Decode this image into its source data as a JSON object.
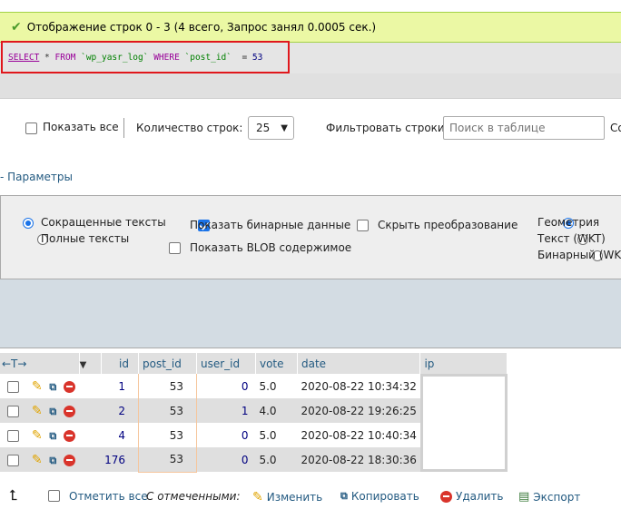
{
  "success": {
    "text": "Отображение строк 0 - 3 (4 всего, Запрос занял 0.0005 сек.)"
  },
  "sql": {
    "select": "SELECT",
    "star": " * ",
    "from": "FROM",
    "table": " `wp_yasr_log` ",
    "where": "WHERE",
    "column": " `post_id` ",
    "eq": " = ",
    "value": "53"
  },
  "controls": {
    "show_all_label": "Показать все",
    "row_count_label": "Количество строк:",
    "row_count_value": "25",
    "filter_label": "Фильтровать строки:",
    "filter_placeholder": "Поиск в таблице",
    "cut_label": "Co"
  },
  "params_link": "- Параметры",
  "options": {
    "short_texts": "Сокращенные тексты",
    "full_texts": "Полные тексты",
    "show_binary": "Показать бинарные данные",
    "show_blob": "Показать BLOB содержимое",
    "hide_transform": "Скрыть преобразование",
    "geometry": "Геометрия",
    "wkt": "Текст (WKT)",
    "wkb": "Бинарный (WKB)"
  },
  "table": {
    "nav_arrows": "←T→",
    "columns": [
      "id",
      "post_id",
      "user_id",
      "vote",
      "date",
      "ip"
    ],
    "rows": [
      {
        "id": "1",
        "post_id": "53",
        "user_id": "0",
        "vote": "5.0",
        "date": "2020-08-22 10:34:32",
        "ip": ""
      },
      {
        "id": "2",
        "post_id": "53",
        "user_id": "1",
        "vote": "4.0",
        "date": "2020-08-22 19:26:25",
        "ip": ""
      },
      {
        "id": "4",
        "post_id": "53",
        "user_id": "0",
        "vote": "5.0",
        "date": "2020-08-22 10:40:34",
        "ip": ""
      },
      {
        "id": "176",
        "post_id": "53",
        "user_id": "0",
        "vote": "5.0",
        "date": "2020-08-22 18:30:36",
        "ip": ""
      }
    ]
  },
  "bottom": {
    "check_all": "Отметить все",
    "with_selected": "С отмеченными:",
    "edit": "Изменить",
    "copy": "Копировать",
    "delete": "Удалить",
    "export": "Экспорт"
  },
  "colors": {
    "success_bg": "#ebf8a4",
    "highlight_border": "#e0171c",
    "link": "#235a81"
  }
}
